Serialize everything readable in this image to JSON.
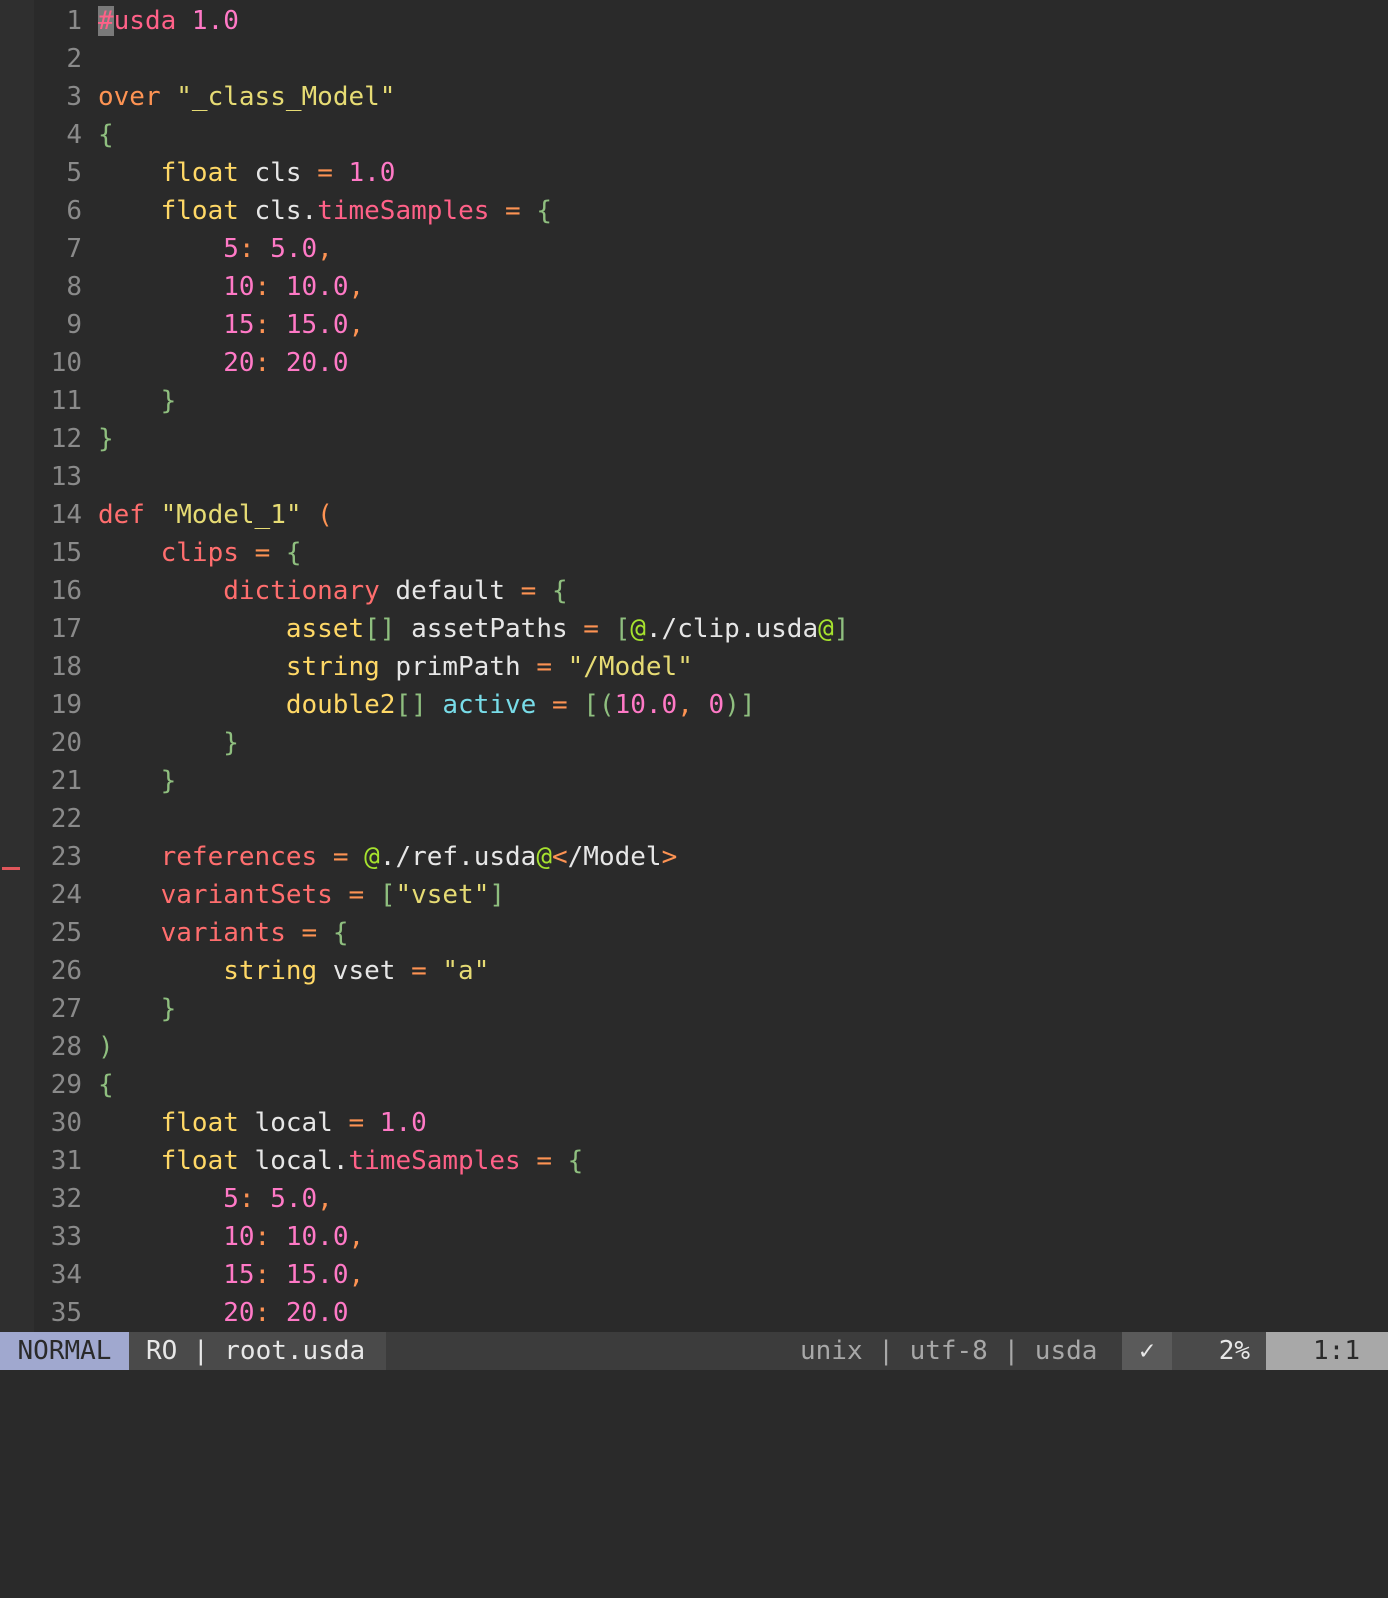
{
  "editor": {
    "lines": [
      {
        "n": "1",
        "t": [
          [
            "cursor",
            "#"
          ],
          [
            "kw",
            "usda"
          ],
          [
            "nu",
            " 1.0"
          ]
        ]
      },
      {
        "n": "2",
        "t": []
      },
      {
        "n": "3",
        "t": [
          [
            "kw2",
            "over"
          ],
          [
            "id",
            " "
          ],
          [
            "st",
            "\"_class_Model\""
          ]
        ]
      },
      {
        "n": "4",
        "t": [
          [
            "br",
            "{"
          ]
        ]
      },
      {
        "n": "5",
        "t": [
          [
            "id",
            "    "
          ],
          [
            "ty",
            "float"
          ],
          [
            "id",
            " cls "
          ],
          [
            "op",
            "="
          ],
          [
            "nu",
            " 1.0"
          ]
        ]
      },
      {
        "n": "6",
        "t": [
          [
            "id",
            "    "
          ],
          [
            "ty",
            "float"
          ],
          [
            "id",
            " cls."
          ],
          [
            "kw",
            "timeSamples"
          ],
          [
            "id",
            " "
          ],
          [
            "op",
            "="
          ],
          [
            "id",
            " "
          ],
          [
            "br",
            "{"
          ]
        ]
      },
      {
        "n": "7",
        "t": [
          [
            "id",
            "        "
          ],
          [
            "nu",
            "5"
          ],
          [
            "op",
            ":"
          ],
          [
            "nu",
            " 5.0"
          ],
          [
            "op",
            ","
          ]
        ]
      },
      {
        "n": "8",
        "t": [
          [
            "id",
            "        "
          ],
          [
            "nu",
            "10"
          ],
          [
            "op",
            ":"
          ],
          [
            "nu",
            " 10.0"
          ],
          [
            "op",
            ","
          ]
        ]
      },
      {
        "n": "9",
        "t": [
          [
            "id",
            "        "
          ],
          [
            "nu",
            "15"
          ],
          [
            "op",
            ":"
          ],
          [
            "nu",
            " 15.0"
          ],
          [
            "op",
            ","
          ]
        ]
      },
      {
        "n": "10",
        "t": [
          [
            "id",
            "        "
          ],
          [
            "nu",
            "20"
          ],
          [
            "op",
            ":"
          ],
          [
            "nu",
            " 20.0"
          ]
        ]
      },
      {
        "n": "11",
        "t": [
          [
            "id",
            "    "
          ],
          [
            "br",
            "}"
          ]
        ]
      },
      {
        "n": "12",
        "t": [
          [
            "br",
            "}"
          ]
        ]
      },
      {
        "n": "13",
        "t": []
      },
      {
        "n": "14",
        "t": [
          [
            "at",
            "def"
          ],
          [
            "id",
            " "
          ],
          [
            "st",
            "\"Model_1\""
          ],
          [
            "id",
            " "
          ],
          [
            "op",
            "("
          ]
        ]
      },
      {
        "n": "15",
        "t": [
          [
            "id",
            "    "
          ],
          [
            "at",
            "clips"
          ],
          [
            "id",
            " "
          ],
          [
            "op",
            "="
          ],
          [
            "id",
            " "
          ],
          [
            "br",
            "{"
          ]
        ]
      },
      {
        "n": "16",
        "t": [
          [
            "id",
            "        "
          ],
          [
            "at",
            "dictionary"
          ],
          [
            "id",
            " default "
          ],
          [
            "op",
            "="
          ],
          [
            "id",
            " "
          ],
          [
            "br",
            "{"
          ]
        ]
      },
      {
        "n": "17",
        "t": [
          [
            "id",
            "            "
          ],
          [
            "ty",
            "asset"
          ],
          [
            "br",
            "[]"
          ],
          [
            "id",
            " assetPaths "
          ],
          [
            "op",
            "="
          ],
          [
            "id",
            " "
          ],
          [
            "br",
            "["
          ],
          [
            "pu",
            "@"
          ],
          [
            "id",
            "./clip.usda"
          ],
          [
            "pu",
            "@"
          ],
          [
            "br",
            "]"
          ]
        ]
      },
      {
        "n": "18",
        "t": [
          [
            "id",
            "            "
          ],
          [
            "ty",
            "string"
          ],
          [
            "id",
            " primPath "
          ],
          [
            "op",
            "="
          ],
          [
            "id",
            " "
          ],
          [
            "st",
            "\"/Model\""
          ]
        ]
      },
      {
        "n": "19",
        "t": [
          [
            "id",
            "            "
          ],
          [
            "ty",
            "double2"
          ],
          [
            "br",
            "[]"
          ],
          [
            "id",
            " "
          ],
          [
            "fn",
            "active"
          ],
          [
            "id",
            " "
          ],
          [
            "op",
            "="
          ],
          [
            "id",
            " "
          ],
          [
            "br",
            "[("
          ],
          [
            "nu",
            "10.0"
          ],
          [
            "op",
            ","
          ],
          [
            "id",
            " "
          ],
          [
            "nu",
            "0"
          ],
          [
            "br",
            ")]"
          ]
        ]
      },
      {
        "n": "20",
        "t": [
          [
            "id",
            "        "
          ],
          [
            "br",
            "}"
          ]
        ]
      },
      {
        "n": "21",
        "t": [
          [
            "id",
            "    "
          ],
          [
            "br",
            "}"
          ]
        ]
      },
      {
        "n": "22",
        "t": []
      },
      {
        "n": "23",
        "t": [
          [
            "id",
            "    "
          ],
          [
            "at",
            "references"
          ],
          [
            "id",
            " "
          ],
          [
            "op",
            "="
          ],
          [
            "id",
            " "
          ],
          [
            "pu",
            "@"
          ],
          [
            "id",
            "./ref.usda"
          ],
          [
            "pu",
            "@"
          ],
          [
            "op",
            "<"
          ],
          [
            "id",
            "/Model"
          ],
          [
            "op",
            ">"
          ]
        ]
      },
      {
        "n": "24",
        "t": [
          [
            "id",
            "    "
          ],
          [
            "at",
            "variantSets"
          ],
          [
            "id",
            " "
          ],
          [
            "op",
            "="
          ],
          [
            "id",
            " "
          ],
          [
            "br",
            "["
          ],
          [
            "st",
            "\"vset\""
          ],
          [
            "br",
            "]"
          ]
        ]
      },
      {
        "n": "25",
        "t": [
          [
            "id",
            "    "
          ],
          [
            "at",
            "variants"
          ],
          [
            "id",
            " "
          ],
          [
            "op",
            "="
          ],
          [
            "id",
            " "
          ],
          [
            "br",
            "{"
          ]
        ]
      },
      {
        "n": "26",
        "t": [
          [
            "id",
            "        "
          ],
          [
            "ty",
            "string"
          ],
          [
            "id",
            " vset "
          ],
          [
            "op",
            "="
          ],
          [
            "id",
            " "
          ],
          [
            "st",
            "\"a\""
          ]
        ]
      },
      {
        "n": "27",
        "t": [
          [
            "id",
            "    "
          ],
          [
            "br",
            "}"
          ]
        ]
      },
      {
        "n": "28",
        "t": [
          [
            "br",
            ")"
          ]
        ]
      },
      {
        "n": "29",
        "t": [
          [
            "br",
            "{"
          ]
        ]
      },
      {
        "n": "30",
        "t": [
          [
            "id",
            "    "
          ],
          [
            "ty",
            "float"
          ],
          [
            "id",
            " local "
          ],
          [
            "op",
            "="
          ],
          [
            "nu",
            " 1.0"
          ]
        ]
      },
      {
        "n": "31",
        "t": [
          [
            "id",
            "    "
          ],
          [
            "ty",
            "float"
          ],
          [
            "id",
            " local."
          ],
          [
            "kw",
            "timeSamples"
          ],
          [
            "id",
            " "
          ],
          [
            "op",
            "="
          ],
          [
            "id",
            " "
          ],
          [
            "br",
            "{"
          ]
        ]
      },
      {
        "n": "32",
        "t": [
          [
            "id",
            "        "
          ],
          [
            "nu",
            "5"
          ],
          [
            "op",
            ":"
          ],
          [
            "nu",
            " 5.0"
          ],
          [
            "op",
            ","
          ]
        ]
      },
      {
        "n": "33",
        "t": [
          [
            "id",
            "        "
          ],
          [
            "nu",
            "10"
          ],
          [
            "op",
            ":"
          ],
          [
            "nu",
            " 10.0"
          ],
          [
            "op",
            ","
          ]
        ]
      },
      {
        "n": "34",
        "t": [
          [
            "id",
            "        "
          ],
          [
            "nu",
            "15"
          ],
          [
            "op",
            ":"
          ],
          [
            "nu",
            " 15.0"
          ],
          [
            "op",
            ","
          ]
        ]
      },
      {
        "n": "35",
        "t": [
          [
            "id",
            "        "
          ],
          [
            "nu",
            "20"
          ],
          [
            "op",
            ":"
          ],
          [
            "nu",
            " 20.0"
          ]
        ]
      }
    ]
  },
  "statusline": {
    "mode": "NORMAL",
    "file": "RO | root.usda",
    "format": "unix | utf-8 | usda",
    "check": "✓",
    "percent": "2%",
    "position": "1:1"
  }
}
